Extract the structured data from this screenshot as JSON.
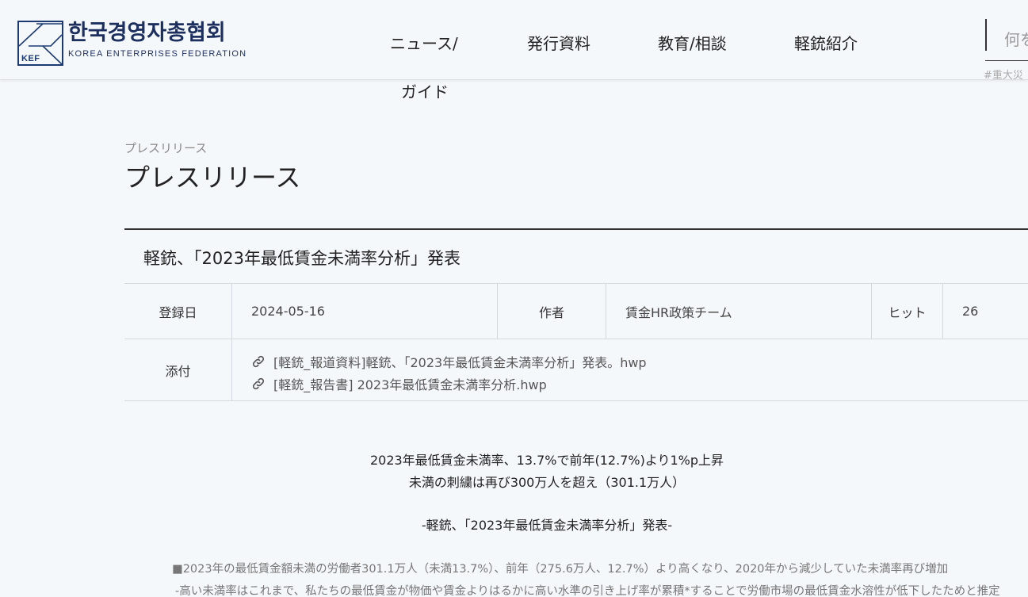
{
  "header": {
    "logo": {
      "kef": "KEF",
      "name_kr": "한국경영자총협회",
      "name_en": "KOREA ENTERPRISES FEDERATION"
    },
    "nav": {
      "news_line1": "ニュース/",
      "news_line2": "ガイド",
      "publications": "発行資料",
      "education": "教育/相談",
      "intro": "軽銃紹介"
    },
    "search": {
      "placeholder": "何を",
      "tag": "#重大災"
    }
  },
  "breadcrumb": "プレスリリース",
  "page_title": "プレスリリース",
  "article": {
    "title": "軽銃、「2023年最低賃金未満率分析」発表",
    "meta": {
      "date_label": "登録日",
      "date": "2024-05-16",
      "author_label": "作者",
      "author": "賃金HR政策チーム",
      "hits_label": "ヒット",
      "hits": "26"
    },
    "attach_label": "添付",
    "attachments": [
      "[軽銃_報道資料]軽銃、「2023年最低賃金未満率分析」発表。hwp",
      "[軽銃_報告書] 2023年最低賃金未満率分析.hwp"
    ],
    "headline1": "2023年最低賃金未満率、13.7%で前年(12.7%)より1%p上昇",
    "headline2": "未満の刺繍は再び300万人を超え（301.1万人）",
    "subheadline": "-軽銃、「2023年最低賃金未満率分析」発表-",
    "para1": "■2023年の最低賃金額未満の労働者301.1万人（未満13.7%）、前年（275.6万人、12.7%）より高くなり、2020年から減少していた未満率再び増加",
    "para2": "-高い未満率はこれまで、私たちの最低賃金が物価や賃金よりはるかに高い水準の引き上げ率が累積*することで労働市場の最低賃金水溶性が低下したためと推定"
  }
}
